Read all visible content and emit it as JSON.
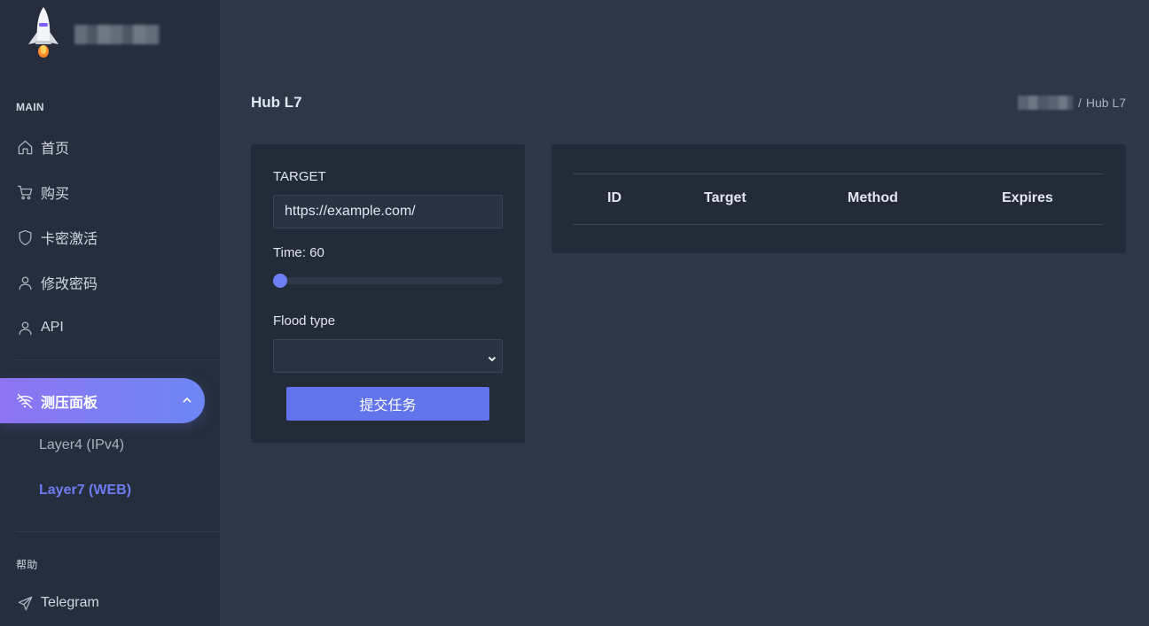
{
  "sidebar": {
    "main_label": "MAIN",
    "items": [
      {
        "label": "首页",
        "icon": "home-icon"
      },
      {
        "label": "购买",
        "icon": "cart-icon"
      },
      {
        "label": "卡密激活",
        "icon": "shield-icon"
      },
      {
        "label": "修改密码",
        "icon": "user-icon"
      },
      {
        "label": "API",
        "icon": "user-icon"
      }
    ],
    "active_item": {
      "label": "测压面板",
      "icon": "wifi-off-icon"
    },
    "sub_items": [
      {
        "label": "Layer4 (IPv4)",
        "active": false
      },
      {
        "label": "Layer7 (WEB)",
        "active": true
      }
    ],
    "help_label": "帮助",
    "help_items": [
      {
        "label": "Telegram",
        "icon": "send-icon"
      }
    ]
  },
  "header": {
    "title": "Hub L7",
    "breadcrumb_sep": "/",
    "breadcrumb_current": "Hub L7"
  },
  "form": {
    "target_label": "TARGET",
    "target_value": "https://example.com/",
    "time_label": "Time: 60",
    "time_slider_fraction": 0,
    "flood_type_label": "Flood type",
    "flood_type_value": "",
    "submit_label": "提交任务"
  },
  "table": {
    "columns": [
      "ID",
      "Target",
      "Method",
      "Expires"
    ],
    "rows": []
  },
  "colors": {
    "accent": "#6274eb",
    "active_link": "#6f7bf0",
    "sidebar_bg": "#262e3d",
    "page_bg": "#2d3748",
    "card_bg": "#232b39"
  }
}
